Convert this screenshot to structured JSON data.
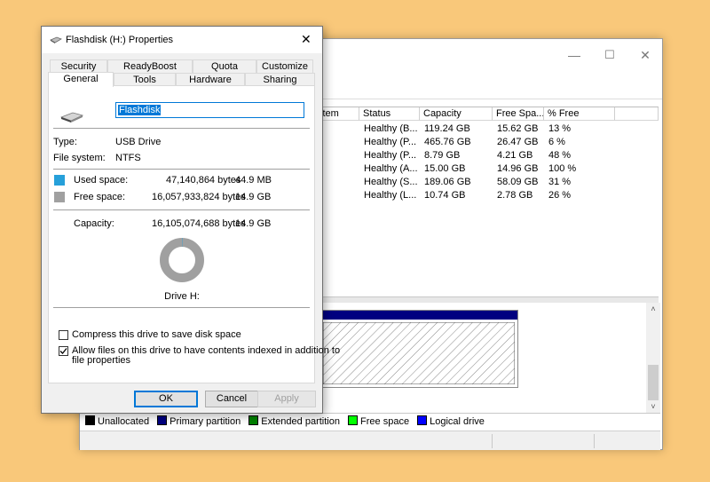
{
  "disk_window": {
    "controls": {
      "minimize": "—",
      "maximize": "☐",
      "close": "✕"
    },
    "columns": [
      "stem",
      "Status",
      "Capacity",
      "Free Spa...",
      "% Free"
    ],
    "rows": [
      {
        "status": "Healthy (B...",
        "capacity": "119.24 GB",
        "free": "15.62 GB",
        "pct": "13 %"
      },
      {
        "status": "Healthy (P...",
        "capacity": "465.76 GB",
        "free": "26.47 GB",
        "pct": "6 %"
      },
      {
        "status": "Healthy (P...",
        "capacity": "8.79 GB",
        "free": "4.21 GB",
        "pct": "48 %"
      },
      {
        "status": "Healthy (A...",
        "capacity": "15.00 GB",
        "free": "14.96 GB",
        "pct": "100 %"
      },
      {
        "status": "Healthy (S...",
        "capacity": "189.06 GB",
        "free": "58.09 GB",
        "pct": "31 %"
      },
      {
        "status": "Healthy (L...",
        "capacity": "10.74 GB",
        "free": "2.78 GB",
        "pct": "26 %"
      }
    ],
    "legend": [
      {
        "label": "Unallocated",
        "color": "#000000"
      },
      {
        "label": "Primary partition",
        "color": "#000080"
      },
      {
        "label": "Extended partition",
        "color": "#008000"
      },
      {
        "label": "Free space",
        "color": "#00ff00"
      },
      {
        "label": "Logical drive",
        "color": "#0000ff"
      }
    ],
    "partition_bar_color": "#000080"
  },
  "dialog": {
    "title": "Flashdisk (H:) Properties",
    "close_glyph": "✕",
    "tabs_row1": [
      "Security",
      "ReadyBoost",
      "Quota",
      "Customize"
    ],
    "tabs_row2": [
      "General",
      "Tools",
      "Hardware",
      "Sharing"
    ],
    "drive_name": "Flashdisk",
    "type_label": "Type:",
    "type_value": "USB Drive",
    "fs_label": "File system:",
    "fs_value": "NTFS",
    "used_label": "Used space:",
    "used_bytes": "47,140,864 bytes",
    "used_size": "44.9 MB",
    "used_color": "#26a0da",
    "free_label": "Free space:",
    "free_bytes": "16,057,933,824 bytes",
    "free_size": "14.9 GB",
    "free_color": "#a0a0a0",
    "capacity_label": "Capacity:",
    "capacity_bytes": "16,105,074,688 bytes",
    "capacity_size": "14.9 GB",
    "used_fraction": 0.003,
    "drive_caption": "Drive H:",
    "compress_label": "Compress this drive to save disk space",
    "compress_checked": false,
    "index_label_line1": "Allow files on this drive to have contents indexed in addition to",
    "index_label_line2": "file properties",
    "index_checked": true,
    "ok": "OK",
    "cancel": "Cancel",
    "apply": "Apply"
  }
}
